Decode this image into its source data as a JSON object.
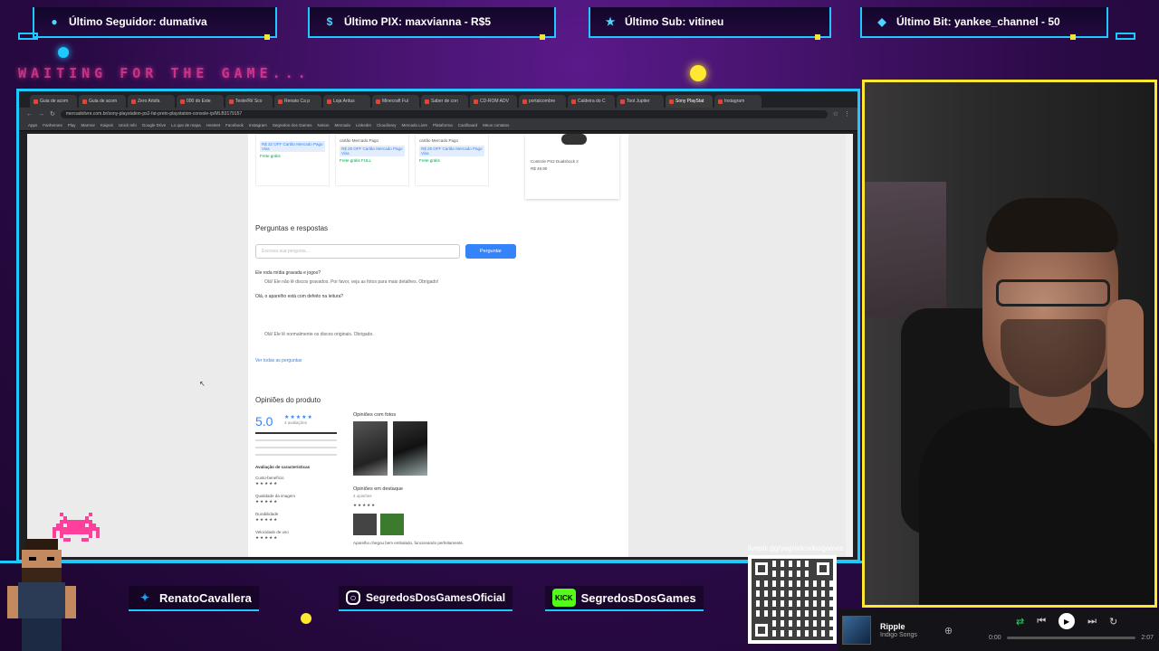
{
  "alerts": {
    "follower": {
      "label": "Último Seguidor: dumativa",
      "icon": "user-icon"
    },
    "pix": {
      "label": "Último PIX: maxvianna - R$5",
      "icon": "dollar-icon"
    },
    "sub": {
      "label": "Último Sub: vitineu",
      "icon": "star-icon"
    },
    "bit": {
      "label": "Último Bit: yankee_channel - 50",
      "icon": "diamond-icon"
    }
  },
  "waiting_text": "WAITING FOR THE GAME...",
  "browser": {
    "tabs": [
      "Guia de acom",
      "Guia de acom",
      "Zero Artsfa",
      "000 do Este",
      "Teste/Ri/ Sco",
      "Renato Ca p",
      "Loja Ardus",
      "Minecraft Ful",
      "Saber de con",
      "CD-ROM ADV",
      "portalcombre",
      "Caldeira do C",
      "Tool Jupiter",
      "Sony PlayStat",
      "Instagram"
    ],
    "url": "mercadolivre.com.br/sony-playstation-ps2-fat-preto-playstation-console-/p/MLB3179157",
    "bookmarks": [
      "Apps",
      "Fanheroes",
      "Play",
      "Marmor",
      "Kaipoti",
      "Unick Info",
      "Google Drive",
      "Lo que de mapa",
      "Hostnet",
      "Facebook",
      "Instagram",
      "Segredos dos Games",
      "Notion",
      "Mercado",
      "LinkedIn",
      "Cloudinary",
      "Mercado Livre",
      "Plataforma",
      "Cardboard",
      "Meus contatos"
    ]
  },
  "page": {
    "cards": [
      {
        "line1": "R$ 32 OFF Cartão Mercado Pago Visa",
        "line2": "Frete grátis"
      },
      {
        "line1": "cartão Mercado Pago",
        "line2": "R$ 28 OFF Cartão Mercado Pago Visa",
        "line3": "Frete grátis FULL"
      },
      {
        "line1": "cartão Mercado Pago",
        "line2": "R$ 28 OFF Cartão Mercado Pago Visa",
        "line3": "Frete grátis"
      }
    ],
    "side_card": {
      "line1": "Controle PS2 Dualshock 2",
      "line2": "R$ 49,90"
    },
    "qa_title": "Perguntas e respostas",
    "qa_placeholder": "Escreva sua pergunta...",
    "qa_button": "Perguntar",
    "qa_question": "Ele roda mídia gravada e jogos?",
    "qa_answer": "Olá! Ele não lê discos gravados. Por favor, veja as fotos para mais detalhes. Obrigado!",
    "qa_question2": "Olá, o aparelho está com defeito na leitura?",
    "qa_answer2": "Olá! Ele lê normalmente os discos originais. Obrigado.",
    "qa_link": "Ver todas as perguntas",
    "reviews_title": "Opiniões do produto",
    "rating": "5.0",
    "rating_count": "4 avaliações",
    "attrs_title": "Avaliação de características",
    "attrs": [
      "Custo-benefício",
      "Qualidade da imagem",
      "Durabilidade",
      "Velocidade de uso"
    ],
    "photos_title": "Opiniões com fotos",
    "featured_title": "Opiniões em destaque",
    "featured_count": "4 opiniões",
    "review_snippet": "Aparelho chegou bem embalado, funcionando perfeitamente."
  },
  "social": {
    "twitter": "RenatoCavallera",
    "instagram": "SegredosDosGamesOficial",
    "kick": "SegredosDosGames"
  },
  "qr_label": "livepix.gg/segredosdosgames",
  "music": {
    "track": "Ripple",
    "artist": "Indigo Songs",
    "time_current": "0:00",
    "time_total": "2:07",
    "progress": 0
  },
  "colors": {
    "accent": "#1ec9ff",
    "highlight": "#ffe830",
    "neon_pink": "#ff3f9b",
    "brand_blue": "#3483fa"
  }
}
